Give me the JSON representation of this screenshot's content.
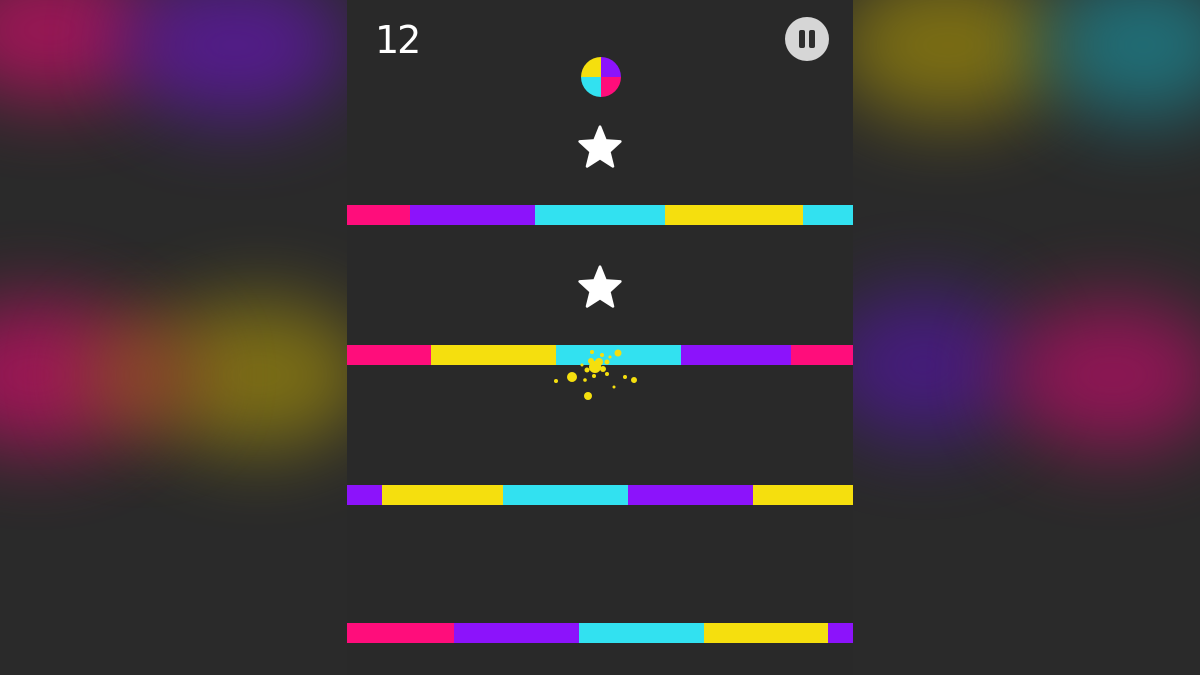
{
  "hud": {
    "score": "12"
  },
  "colors": {
    "pink": "#ff0d7b",
    "purple": "#8c13fb",
    "cyan": "#32e1f0",
    "yellow": "#f5df0e",
    "background": "#292929",
    "pause_button": "#d6d6d6"
  },
  "icons": {
    "pause": "pause-icon",
    "star": "star-icon",
    "color_switcher": "color-switcher-icon"
  },
  "stars": 2,
  "bars": [
    [
      "pink",
      "purple",
      "cyan",
      "yellow",
      "cyan"
    ],
    [
      "pink",
      "yellow",
      "cyan",
      "purple",
      "pink"
    ],
    [
      "purple",
      "yellow",
      "cyan",
      "purple",
      "yellow"
    ],
    [
      "pink",
      "purple",
      "cyan",
      "yellow",
      "purple"
    ]
  ],
  "player": {
    "color": "yellow",
    "state": "burst"
  }
}
